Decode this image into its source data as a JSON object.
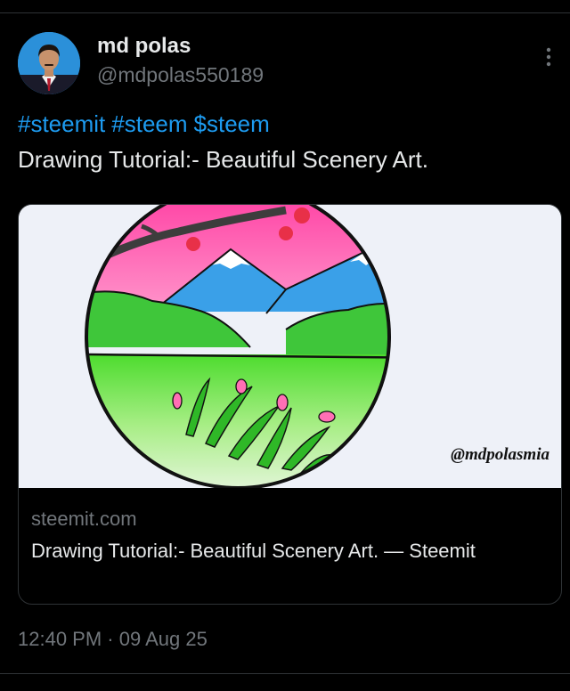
{
  "author": {
    "display_name": "md polas",
    "handle": "@mdpolas550189",
    "avatar_icon": "user-avatar"
  },
  "tweet": {
    "hashtags": [
      "#steemit",
      "#steem",
      "$steem"
    ],
    "text": "Drawing Tutorial:- Beautiful Scenery Art."
  },
  "card": {
    "image_watermark": "@mdpolasmia",
    "domain": "steemit.com",
    "title": "Drawing Tutorial:- Beautiful Scenery Art. — Steemit"
  },
  "meta": {
    "timestamp": "12:40 PM · 09 Aug 25"
  },
  "colors": {
    "background": "#000000",
    "text_primary": "#e7e9ea",
    "text_secondary": "#71767b",
    "link": "#1d9bf0",
    "border": "#2f3336"
  }
}
